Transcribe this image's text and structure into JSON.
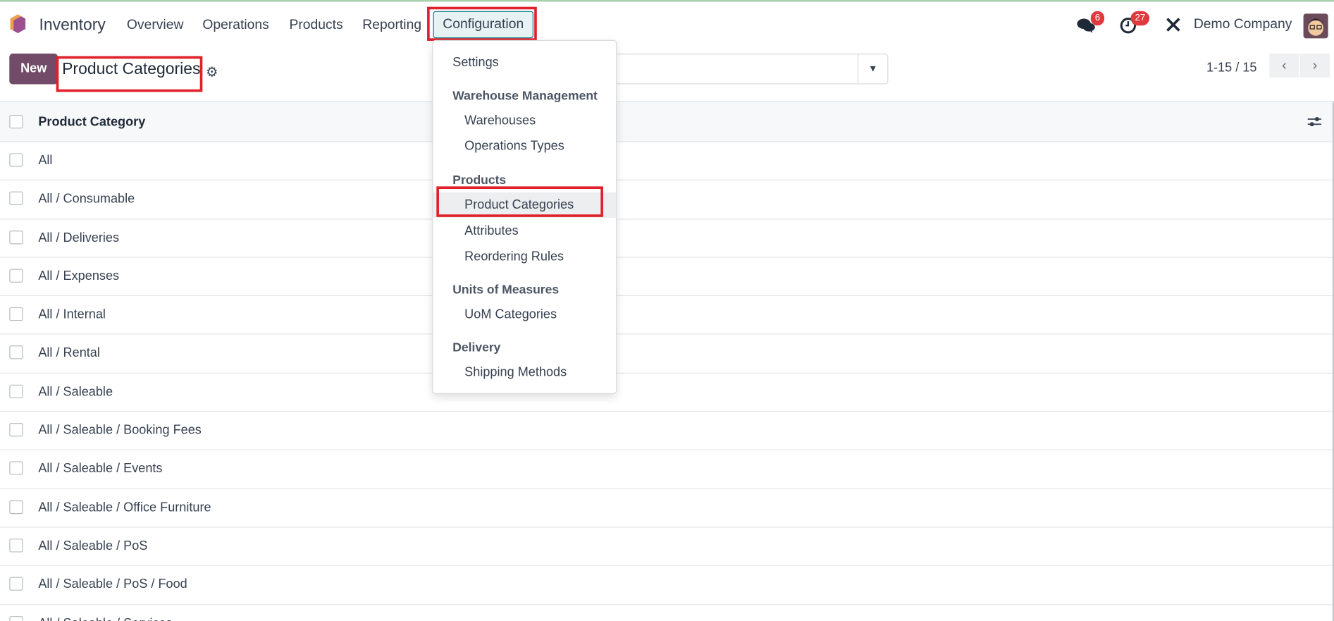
{
  "nav": {
    "app_name": "Inventory",
    "menus": [
      "Overview",
      "Operations",
      "Products",
      "Reporting",
      "Configuration"
    ],
    "messages_count": "6",
    "activities_count": "27",
    "company": "Demo Company"
  },
  "control": {
    "new_label": "New",
    "title": "Product Categories",
    "pager": "1-15 / 15"
  },
  "table": {
    "header": "Product Category",
    "rows": [
      "All",
      "All / Consumable",
      "All / Deliveries",
      "All / Expenses",
      "All / Internal",
      "All / Rental",
      "All / Saleable",
      "All / Saleable / Booking Fees",
      "All / Saleable / Events",
      "All / Saleable / Office Furniture",
      "All / Saleable / PoS",
      "All / Saleable / PoS / Food",
      "All / Saleable / Services"
    ]
  },
  "dropdown": {
    "settings": "Settings",
    "warehouse_header": "Warehouse Management",
    "warehouses": "Warehouses",
    "operation_types": "Operations Types",
    "products_header": "Products",
    "product_categories": "Product Categories",
    "attributes": "Attributes",
    "reordering": "Reordering Rules",
    "uom_header": "Units of Measures",
    "uom_categories": "UoM Categories",
    "delivery_header": "Delivery",
    "shipping": "Shipping Methods"
  },
  "colors": {
    "brand": "#714b67",
    "highlight": "#e0202a",
    "badge": "#e0393e",
    "accent": "#017e84"
  }
}
